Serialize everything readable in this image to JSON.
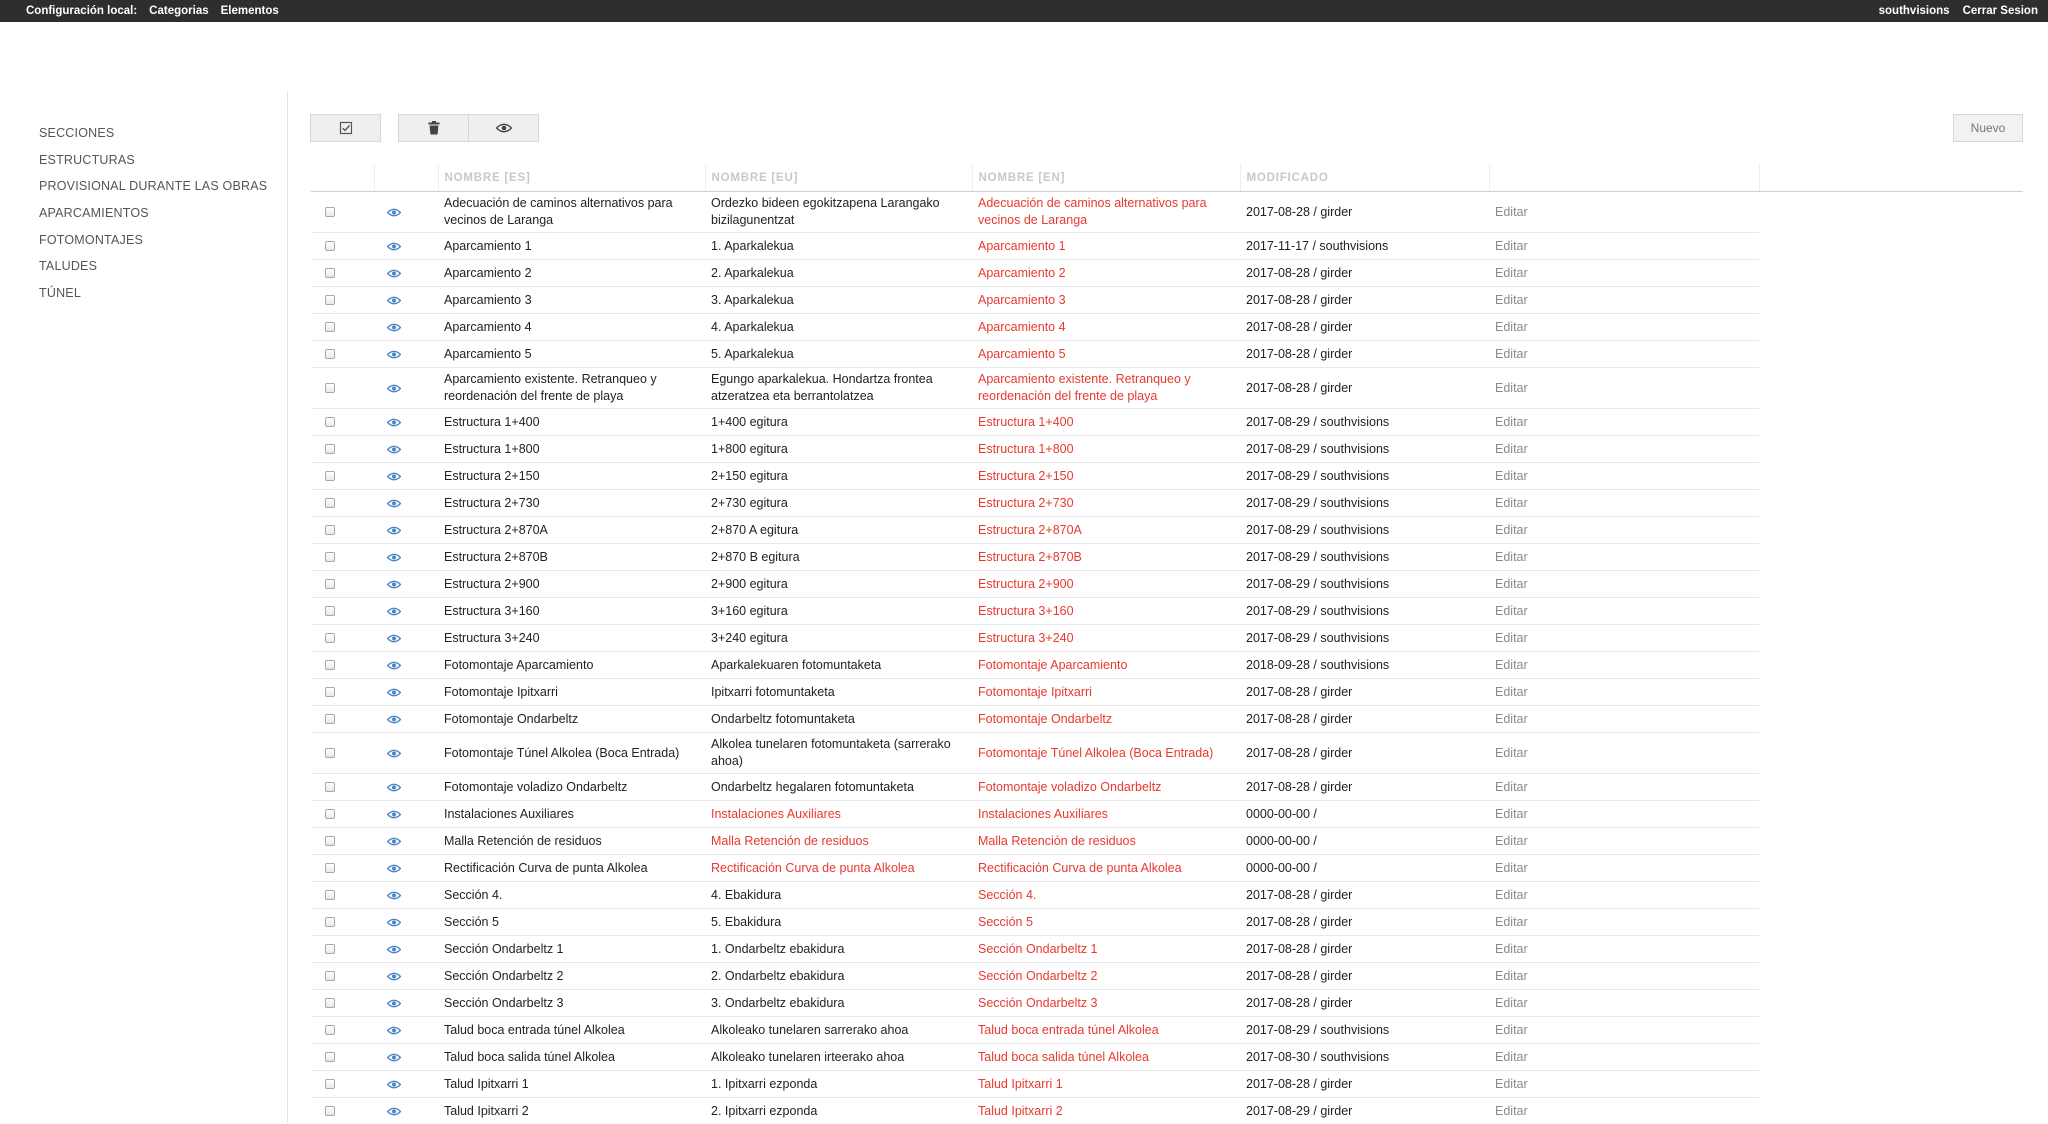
{
  "topbar": {
    "config_label": "Configuración local:",
    "categorias": "Categorias",
    "elementos": "Elementos",
    "user": "southvisions",
    "logout": "Cerrar Sesion"
  },
  "sidebar": {
    "items": [
      {
        "label": "SECCIONES"
      },
      {
        "label": "ESTRUCTURAS"
      },
      {
        "label": "PROVISIONAL DURANTE LAS OBRAS"
      },
      {
        "label": "APARCAMIENTOS"
      },
      {
        "label": "FOTOMONTAJES"
      },
      {
        "label": "TALUDES"
      },
      {
        "label": "TÚNEL"
      }
    ]
  },
  "toolbar": {
    "icons": [
      "checkbox-icon",
      "trash-icon",
      "eye-icon"
    ],
    "new_label": "Nuevo"
  },
  "colors": {
    "accent_red": "#e8392f",
    "eye_blue": "#4a86c8",
    "topbar": "#2e2e2e"
  },
  "table": {
    "headers": {
      "es": "NOMBRE [ES]",
      "eu": "NOMBRE [EU]",
      "en": "NOMBRE [EN]",
      "mod": "MODIFICADO"
    },
    "edit_label": "Editar",
    "rows": [
      {
        "es": "Adecuación de caminos alternativos para vecinos de Laranga",
        "eu": "Ordezko bideen egokitzapena Larangako bizilagunentzat",
        "en": "Adecuación de caminos alternativos para vecinos de Laranga",
        "mod": "2017-08-28 / girder",
        "tall": true
      },
      {
        "es": "Aparcamiento 1",
        "eu": "1. Aparkalekua",
        "en": "Aparcamiento 1",
        "mod": "2017-11-17 / southvisions"
      },
      {
        "es": "Aparcamiento 2",
        "eu": "2. Aparkalekua",
        "en": "Aparcamiento 2",
        "mod": "2017-08-28 / girder"
      },
      {
        "es": "Aparcamiento 3",
        "eu": "3. Aparkalekua",
        "en": "Aparcamiento 3",
        "mod": "2017-08-28 / girder"
      },
      {
        "es": "Aparcamiento 4",
        "eu": "4. Aparkalekua",
        "en": "Aparcamiento 4",
        "mod": "2017-08-28 / girder"
      },
      {
        "es": "Aparcamiento 5",
        "eu": "5. Aparkalekua",
        "en": "Aparcamiento 5",
        "mod": "2017-08-28 / girder"
      },
      {
        "es": "Aparcamiento existente. Retranqueo y reordenación del frente de playa",
        "eu": "Egungo aparkalekua. Hondartza frontea atzeratzea eta berrantolatzea",
        "en": "Aparcamiento existente. Retranqueo y reordenación del frente de playa",
        "mod": "2017-08-28 / girder",
        "tall": true
      },
      {
        "es": "Estructura 1+400",
        "eu": "1+400 egitura",
        "en": "Estructura 1+400",
        "mod": "2017-08-29 / southvisions"
      },
      {
        "es": "Estructura 1+800",
        "eu": "1+800 egitura",
        "en": "Estructura 1+800",
        "mod": "2017-08-29 / southvisions"
      },
      {
        "es": "Estructura 2+150",
        "eu": "2+150 egitura",
        "en": "Estructura 2+150",
        "mod": "2017-08-29 / southvisions"
      },
      {
        "es": "Estructura 2+730",
        "eu": "2+730 egitura",
        "en": "Estructura 2+730",
        "mod": "2017-08-29 / southvisions"
      },
      {
        "es": "Estructura 2+870A",
        "eu": "2+870 A egitura",
        "en": "Estructura 2+870A",
        "mod": "2017-08-29 / southvisions"
      },
      {
        "es": "Estructura 2+870B",
        "eu": "2+870 B egitura",
        "en": "Estructura 2+870B",
        "mod": "2017-08-29 / southvisions"
      },
      {
        "es": "Estructura 2+900",
        "eu": "2+900 egitura",
        "en": "Estructura 2+900",
        "mod": "2017-08-29 / southvisions"
      },
      {
        "es": "Estructura 3+160",
        "eu": "3+160 egitura",
        "en": "Estructura 3+160",
        "mod": "2017-08-29 / southvisions"
      },
      {
        "es": "Estructura 3+240",
        "eu": "3+240 egitura",
        "en": "Estructura 3+240",
        "mod": "2017-08-29 / southvisions"
      },
      {
        "es": "Fotomontaje Aparcamiento",
        "eu": "Aparkalekuaren fotomuntaketa",
        "en": "Fotomontaje Aparcamiento",
        "mod": "2018-09-28 / southvisions"
      },
      {
        "es": "Fotomontaje Ipitxarri",
        "eu": "Ipitxarri fotomuntaketa",
        "en": "Fotomontaje Ipitxarri",
        "mod": "2017-08-28 / girder"
      },
      {
        "es": "Fotomontaje Ondarbeltz",
        "eu": "Ondarbeltz fotomuntaketa",
        "en": "Fotomontaje Ondarbeltz",
        "mod": "2017-08-28 / girder"
      },
      {
        "es": "Fotomontaje Túnel Alkolea (Boca Entrada)",
        "eu": "Alkolea tunelaren fotomuntaketa (sarrerako ahoa)",
        "en": "Fotomontaje Túnel Alkolea (Boca Entrada)",
        "mod": "2017-08-28 / girder",
        "tall": true
      },
      {
        "es": "Fotomontaje voladizo Ondarbeltz",
        "eu": "Ondarbeltz hegalaren fotomuntaketa",
        "en": "Fotomontaje voladizo Ondarbeltz",
        "mod": "2017-08-28 / girder"
      },
      {
        "es": "Instalaciones Auxiliares",
        "eu": "Instalaciones Auxiliares",
        "en": "Instalaciones Auxiliares",
        "mod": "0000-00-00 /",
        "eu_red": true
      },
      {
        "es": "Malla Retención de residuos",
        "eu": "Malla Retención de residuos",
        "en": "Malla Retención de residuos",
        "mod": "0000-00-00 /",
        "eu_red": true
      },
      {
        "es": "Rectificación Curva de punta Alkolea",
        "eu": "Rectificación Curva de punta Alkolea",
        "en": "Rectificación Curva de punta Alkolea",
        "mod": "0000-00-00 /",
        "eu_red": true
      },
      {
        "es": "Sección 4.",
        "eu": "4. Ebakidura",
        "en": "Sección 4.",
        "mod": "2017-08-28 / girder"
      },
      {
        "es": "Sección 5",
        "eu": "5. Ebakidura",
        "en": "Sección 5",
        "mod": "2017-08-28 / girder"
      },
      {
        "es": "Sección Ondarbeltz 1",
        "eu": "1. Ondarbeltz ebakidura",
        "en": "Sección Ondarbeltz 1",
        "mod": "2017-08-28 / girder"
      },
      {
        "es": "Sección Ondarbeltz 2",
        "eu": "2. Ondarbeltz ebakidura",
        "en": "Sección Ondarbeltz 2",
        "mod": "2017-08-28 / girder"
      },
      {
        "es": "Sección Ondarbeltz 3",
        "eu": "3. Ondarbeltz ebakidura",
        "en": "Sección Ondarbeltz 3",
        "mod": "2017-08-28 / girder"
      },
      {
        "es": "Talud boca entrada túnel Alkolea",
        "eu": "Alkoleako tunelaren sarrerako ahoa",
        "en": "Talud boca entrada túnel Alkolea",
        "mod": "2017-08-29 / southvisions"
      },
      {
        "es": "Talud boca salida túnel Alkolea",
        "eu": "Alkoleako tunelaren irteerako ahoa",
        "en": "Talud boca salida túnel Alkolea",
        "mod": "2017-08-30 / southvisions"
      },
      {
        "es": "Talud Ipitxarri 1",
        "eu": "1. Ipitxarri ezponda",
        "en": "Talud Ipitxarri 1",
        "mod": "2017-08-28 / girder"
      },
      {
        "es": "Talud Ipitxarri 2",
        "eu": "2. Ipitxarri ezponda",
        "en": "Talud Ipitxarri 2",
        "mod": "2017-08-29 / girder"
      }
    ]
  }
}
